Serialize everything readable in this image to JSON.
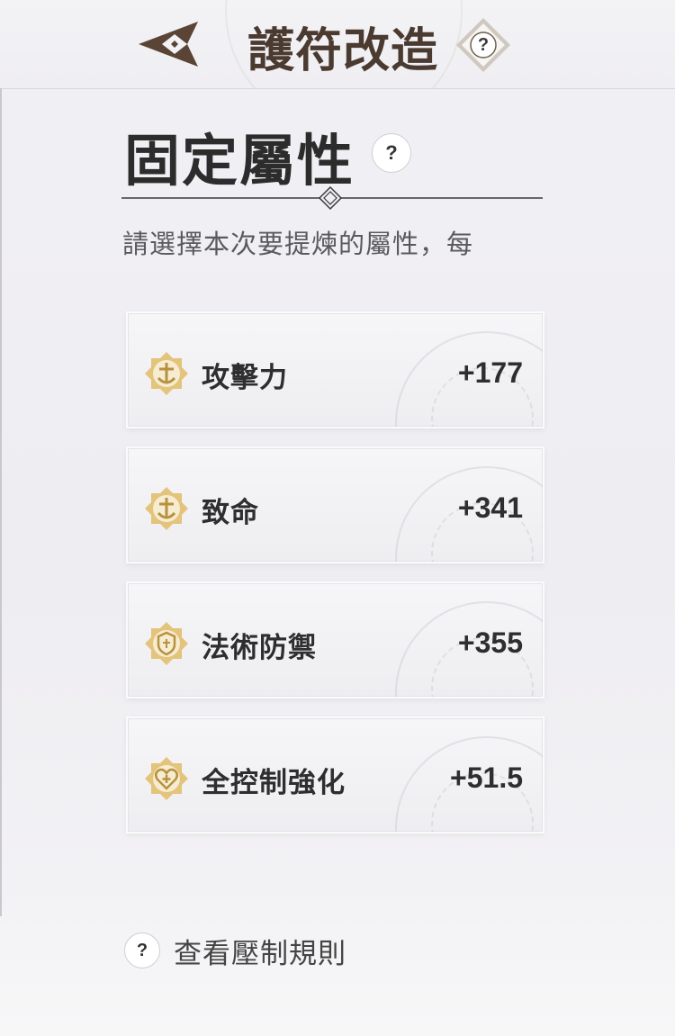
{
  "header": {
    "title": "護符改造",
    "help_label": "?"
  },
  "section": {
    "title": "固定屬性",
    "help_label": "?",
    "subtitle": "請選擇本次要提煉的屬性，每"
  },
  "attributes": [
    {
      "name": "攻擊力",
      "value": "+177",
      "icon": "anchor-badge-icon"
    },
    {
      "name": "致命",
      "value": "+341",
      "icon": "anchor-badge-icon"
    },
    {
      "name": "法術防禦",
      "value": "+355",
      "icon": "shield-badge-icon"
    },
    {
      "name": "全控制強化",
      "value": "+51.5",
      "icon": "heart-cross-badge-icon"
    }
  ],
  "footer": {
    "rules_icon_label": "?",
    "rules_text": "查看壓制規則"
  },
  "colors": {
    "accent_gold": "#d9b466",
    "header_brown": "#5a4436"
  }
}
